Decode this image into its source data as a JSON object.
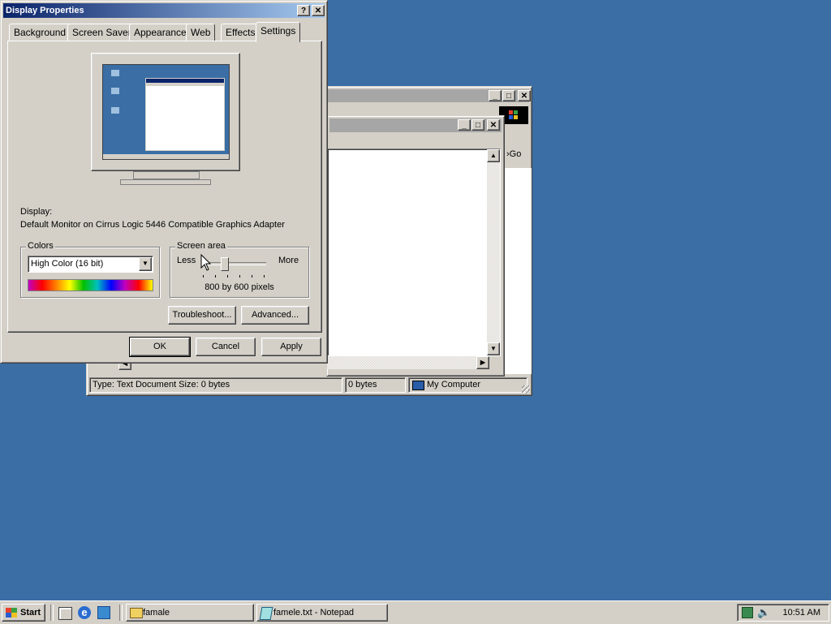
{
  "display_props": {
    "title": "Display Properties",
    "help_btn": "?",
    "close_btn": "✕",
    "tabs": [
      "Background",
      "Screen Saver",
      "Appearance",
      "Web",
      "Effects",
      "Settings"
    ],
    "display_label": "Display:",
    "display_value": "Default Monitor on Cirrus Logic 5446 Compatible Graphics Adapter",
    "colors_group": "Colors",
    "colors_value": "High Color (16 bit)",
    "screen_area_group": "Screen area",
    "less_label": "Less",
    "more_label": "More",
    "resolution": "800 by 600 pixels",
    "slider_level": 0.33,
    "troubleshoot_btn": "Troubleshoot...",
    "advanced_btn": "Advanced...",
    "ok_btn": "OK",
    "cancel_btn": "Cancel",
    "apply_btn": "Apply"
  },
  "explorer": {
    "go_label": "Go",
    "status_type": "Type: Text Document Size: 0 bytes",
    "status_size": "0 bytes",
    "status_location": "My Computer"
  },
  "taskbar": {
    "start_label": "Start",
    "tasks": [
      "famale",
      "famele.txt - Notepad"
    ],
    "clock": "10:51 AM"
  },
  "colors": {
    "desktop": "#3a6ea5",
    "title_active": "#0a246a",
    "face": "#d4d0c8"
  }
}
